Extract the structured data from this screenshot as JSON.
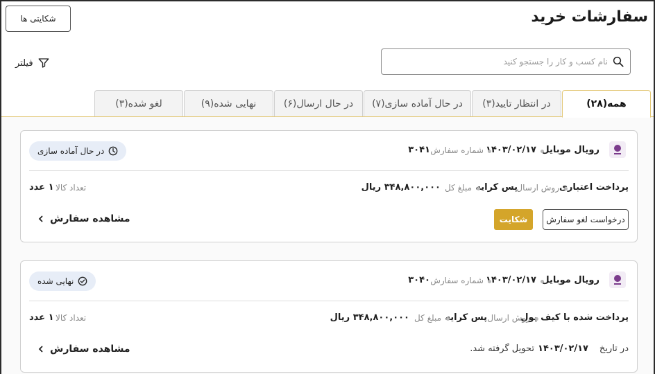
{
  "header": {
    "title": "سفارشات خرید",
    "complaints_label": "شکایتی ها",
    "filter_label": "فیلتر",
    "search_placeholder": "نام کسب و کار را جستجو کنید"
  },
  "tabs": [
    {
      "label": "همه(۲۸)",
      "active": true
    },
    {
      "label": "در انتظار تایید(۳)"
    },
    {
      "label": "در حال آماده سازی(۷)"
    },
    {
      "label": "در حال ارسال(۶)"
    },
    {
      "label": "نهایی شده(۹)"
    },
    {
      "label": "لغو شده(۳)"
    }
  ],
  "orders": [
    {
      "shop_name": "رویال موبایل",
      "date": "۱۴۰۳/۰۲/۱۷",
      "order_number_label": "شماره سفارش",
      "order_number": "۳۰۴۱",
      "status": "در حال آماده سازی",
      "status_icon": "clock-icon",
      "payment": "پرداخت اعتباری",
      "shipping_label": "روش ارسال",
      "shipping": "پس کرایه",
      "amount_label": "مبلغ کل",
      "amount": "۳۴۸,۸۰۰,۰۰۰ ریال",
      "items_label": "تعداد کالا",
      "items_count": "۱ عدد",
      "view_label": "مشاهده سفارش",
      "cancel_label": "درخواست لغو سفارش",
      "complaint_label": "شکایت"
    },
    {
      "shop_name": "رویال موبایل",
      "date": "۱۴۰۳/۰۲/۱۷",
      "order_number_label": "شماره سفارش",
      "order_number": "۳۰۴۰",
      "status": "نهایی شده",
      "status_icon": "check-circle-icon",
      "payment": "پرداخت شده با کیف پول",
      "shipping_label": "روش ارسال",
      "shipping": "پس کرایه",
      "amount_label": "مبلغ کل",
      "amount": "۳۴۸,۸۰۰,۰۰۰ ریال",
      "items_label": "تعداد کالا",
      "items_count": "۱ عدد",
      "view_label": "مشاهده سفارش",
      "delivered_prefix": "در تاریخ",
      "delivered_date": "۱۴۰۳/۰۲/۱۷",
      "delivered_suffix": "تحویل گرفته شد."
    }
  ],
  "colors": {
    "accent": "#d4a52a",
    "tab_active_border": "#e3c877",
    "status_bg": "#e7edf7"
  }
}
